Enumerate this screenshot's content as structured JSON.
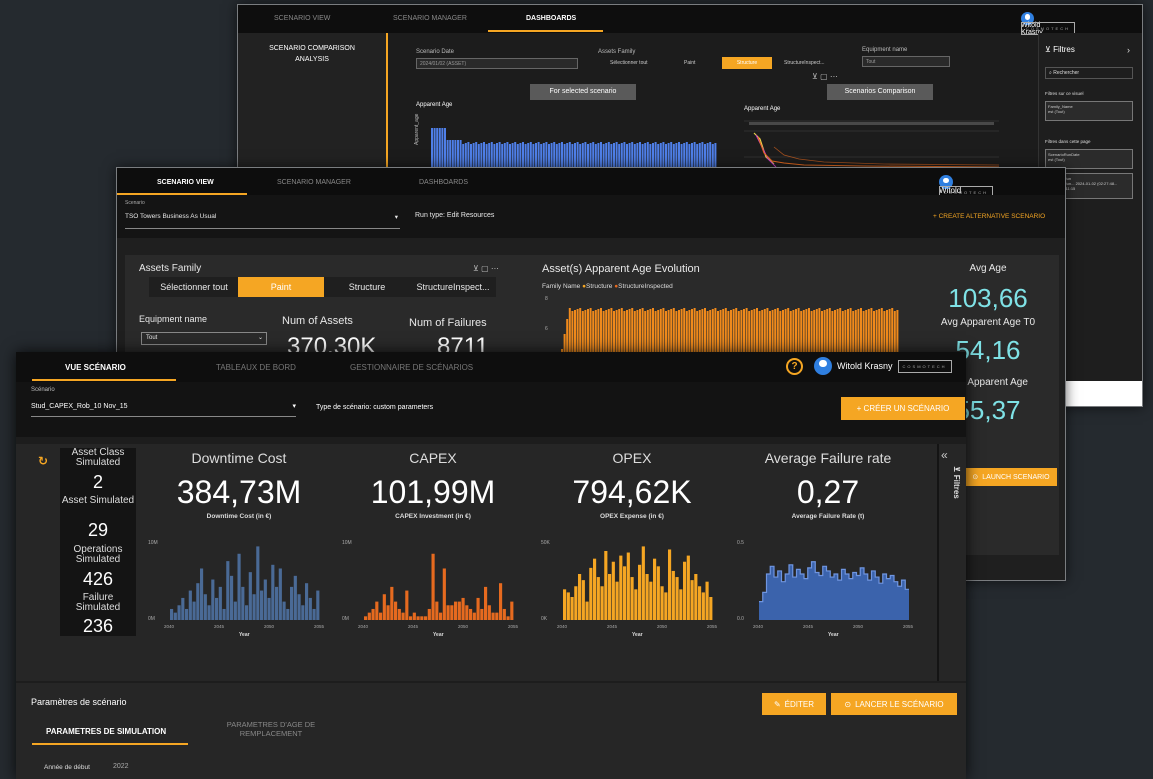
{
  "back_window": {
    "nav": [
      "SCENARIO VIEW",
      "SCENARIO MANAGER",
      "DASHBOARDS"
    ],
    "active_tab": "DASHBOARDS",
    "user": "Witold Krasny",
    "logo": "COSMOTECH",
    "left_title": "SCENARIO COMPARISON ANALYSIS",
    "scenario_date_label": "Scenario Date",
    "scenario_date_value": "2024/01/02 (ASSET)",
    "assets_family_label": "Assets Family",
    "family_options": [
      "Sélectionner tout",
      "Paint",
      "Structure",
      "StructureInspect..."
    ],
    "family_selected": "Structure",
    "equipment_label": "Equipment name",
    "equipment_value": "Tout",
    "btn_selected": "For selected scenario",
    "btn_comparison": "Scenarios Comparison",
    "apparent_age_1": "Apparent Age",
    "apparent_age_2": "Apparent Age",
    "ylabel": "Apparent_age",
    "filters": {
      "title": "Filtres",
      "search": "Rechercher",
      "on_visual": "Filtres sur ce visuel",
      "f1_name": "Family_Name",
      "f1_val": "est (Tout)",
      "on_page": "Filtres dans cette page",
      "f2_name": "ScenarioRunDate",
      "f2_val": "est (Tout)",
      "f3_name": "ScenarioRun",
      "f3_val": "ScenarioRun... 2024-01-02 (02:27:48...",
      "f3_val2": "est 19:03:11:15"
    }
  },
  "middle_window": {
    "nav": [
      "SCENARIO VIEW",
      "SCENARIO MANAGER",
      "DASHBOARDS"
    ],
    "user": "Witold Krasny",
    "logo": "COSMOTECH",
    "scenario_label": "Scenario",
    "scenario_value": "TSO Towers Business As Usual",
    "run_type": "Run type: Edit Resources",
    "create_alt": "+ CREATE ALTERNATIVE SCENARIO",
    "assets_family": "Assets Family",
    "family_options": [
      "Sélectionner tout",
      "Paint",
      "Structure",
      "StructureInspect..."
    ],
    "family_selected": "Paint",
    "equipment_label": "Equipment name",
    "equipment_value": "Tout",
    "num_assets_label": "Num of Assets",
    "num_assets": "370,30K",
    "num_failures_label": "Num of Failures",
    "num_failures": "8711",
    "chart_title": "Asset(s) Apparent Age Evolution",
    "legend_title": "Family Name",
    "legend": [
      "Structure",
      "StructureInspected"
    ],
    "y_ticks": [
      "8",
      "6"
    ],
    "avg_age_label": "Avg Age",
    "avg_age": "103,66",
    "avg_app_t0_label": "Avg Apparent Age T0",
    "avg_app_t0": "54,16",
    "avg_app_label": "Avg Apparent Age",
    "avg_app": "55,37",
    "launch": "LAUNCH SCENARIO"
  },
  "front_window": {
    "nav": [
      "VUE SCÉNARIO",
      "TABLEAUX DE BORD",
      "GESTIONNAIRE DE SCÉNARIOS"
    ],
    "user": "Witold Krasny",
    "logo": "COSMOTECH",
    "scenario_label": "Scénario",
    "scenario_value": "Stud_CAPEX_Rob_10 Nov_15",
    "type_text": "Type de scénario: custom parameters",
    "create_btn": "+ CRÉER UN SCÉNARIO",
    "filtres": "Filtres",
    "stats": [
      {
        "label": "Asset Class Simulated",
        "value": "2"
      },
      {
        "label": "Asset Simulated",
        "value": "29"
      },
      {
        "label": "Operations Simulated",
        "value": "426"
      },
      {
        "label": "Failure Simulated",
        "value": "236"
      }
    ],
    "kpis": [
      {
        "title": "Downtime Cost",
        "value": "384,73M",
        "sub": "Downtime Cost (in €)",
        "color": "#4a6a96",
        "ytop": "10M",
        "ybot": "0M",
        "x": [
          "2040",
          "2045",
          "2050",
          "2055"
        ],
        "xlabel": "Year"
      },
      {
        "title": "CAPEX",
        "value": "101,99M",
        "sub": "CAPEX Investment (in €)",
        "color": "#e66a1f",
        "ytop": "10M",
        "ybot": "0M",
        "x": [
          "2040",
          "2045",
          "2050",
          "2055"
        ],
        "xlabel": "Year"
      },
      {
        "title": "OPEX",
        "value": "794,62K",
        "sub": "OPEX Expense (in €)",
        "color": "#f5a623",
        "ytop": "50K",
        "ybot": "0K",
        "x": [
          "2040",
          "2045",
          "2050",
          "2055"
        ],
        "xlabel": "Year"
      },
      {
        "title": "Average Failure rate",
        "value": "0,27",
        "sub": "Average Failure Rate (t)",
        "color": "#3f6fc4",
        "ytop": "0.5",
        "ybot": "0.0",
        "x": [
          "2040",
          "2045",
          "2050",
          "2055"
        ],
        "xlabel": "Year"
      }
    ],
    "params_title": "Paramètres de scénario",
    "edit_btn": "ÉDITER",
    "launch_btn": "LANCER LE SCÉNARIO",
    "tab_sim": "PARAMETRES DE SIMULATION",
    "tab_repl": "PARAMETRES D'AGE DE REMPLACEMENT",
    "start_year_label": "Année de début",
    "start_year": "2022"
  },
  "chart_data": [
    {
      "type": "bar",
      "title": "Downtime Cost",
      "ylim": [
        0,
        25
      ],
      "values": [
        3,
        2,
        4,
        6,
        3,
        8,
        5,
        10,
        14,
        7,
        4,
        11,
        6,
        9,
        3,
        16,
        12,
        5,
        18,
        9,
        4,
        13,
        7,
        20,
        8,
        11,
        6,
        15,
        9,
        14,
        5,
        3,
        9,
        12,
        7,
        4,
        10,
        6,
        3,
        8
      ]
    },
    {
      "type": "bar",
      "title": "CAPEX",
      "ylim": [
        0,
        25
      ],
      "values": [
        1,
        2,
        3,
        5,
        2,
        7,
        4,
        9,
        5,
        3,
        2,
        8,
        1,
        2,
        1,
        1,
        1,
        3,
        18,
        5,
        2,
        14,
        4,
        4,
        5,
        5,
        6,
        4,
        3,
        2,
        6,
        3,
        9,
        4,
        2,
        2,
        10,
        3,
        1,
        5
      ]
    },
    {
      "type": "bar",
      "title": "OPEX",
      "ylim": [
        0,
        60
      ],
      "values": [
        20,
        18,
        15,
        22,
        30,
        26,
        12,
        34,
        40,
        28,
        22,
        45,
        30,
        38,
        25,
        42,
        35,
        44,
        28,
        20,
        36,
        48,
        30,
        25,
        40,
        35,
        22,
        18,
        46,
        32,
        28,
        20,
        38,
        42,
        26,
        30,
        22,
        18,
        25,
        15
      ]
    },
    {
      "type": "bar",
      "title": "Average Failure rate",
      "ylim": [
        0,
        0.6
      ],
      "values": [
        0.12,
        0.18,
        0.3,
        0.35,
        0.28,
        0.32,
        0.25,
        0.3,
        0.36,
        0.28,
        0.33,
        0.3,
        0.27,
        0.34,
        0.38,
        0.31,
        0.29,
        0.35,
        0.32,
        0.28,
        0.3,
        0.26,
        0.33,
        0.3,
        0.27,
        0.31,
        0.29,
        0.34,
        0.3,
        0.26,
        0.32,
        0.28,
        0.24,
        0.3,
        0.27,
        0.29,
        0.25,
        0.22,
        0.26,
        0.2
      ]
    }
  ]
}
